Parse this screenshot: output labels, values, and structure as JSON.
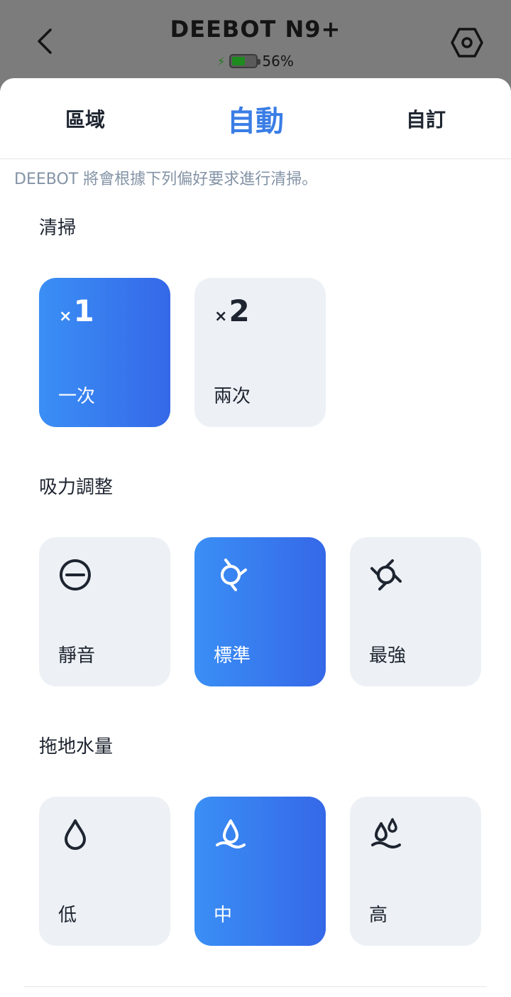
{
  "header": {
    "title": "DEEBOT N9+",
    "battery_percent": 56,
    "battery_text": "56%"
  },
  "tabs": [
    {
      "label": "區域"
    },
    {
      "label": "自動"
    },
    {
      "label": "自訂"
    }
  ],
  "description": "DEEBOT 將會根據下列偏好要求進行清掃。",
  "sections": {
    "sweep": {
      "title": "清掃",
      "options": [
        {
          "icon_text": "1",
          "label": "一次"
        },
        {
          "icon_text": "2",
          "label": "兩次"
        }
      ]
    },
    "suction": {
      "title": "吸力調整",
      "options": [
        {
          "label": "靜音"
        },
        {
          "label": "標準"
        },
        {
          "label": "最強"
        }
      ]
    },
    "water": {
      "title": "拖地水量",
      "options": [
        {
          "label": "低"
        },
        {
          "label": "中"
        },
        {
          "label": "高"
        }
      ]
    }
  },
  "colors": {
    "accent": "#3a7de6",
    "card_bg": "#edf1f5"
  }
}
